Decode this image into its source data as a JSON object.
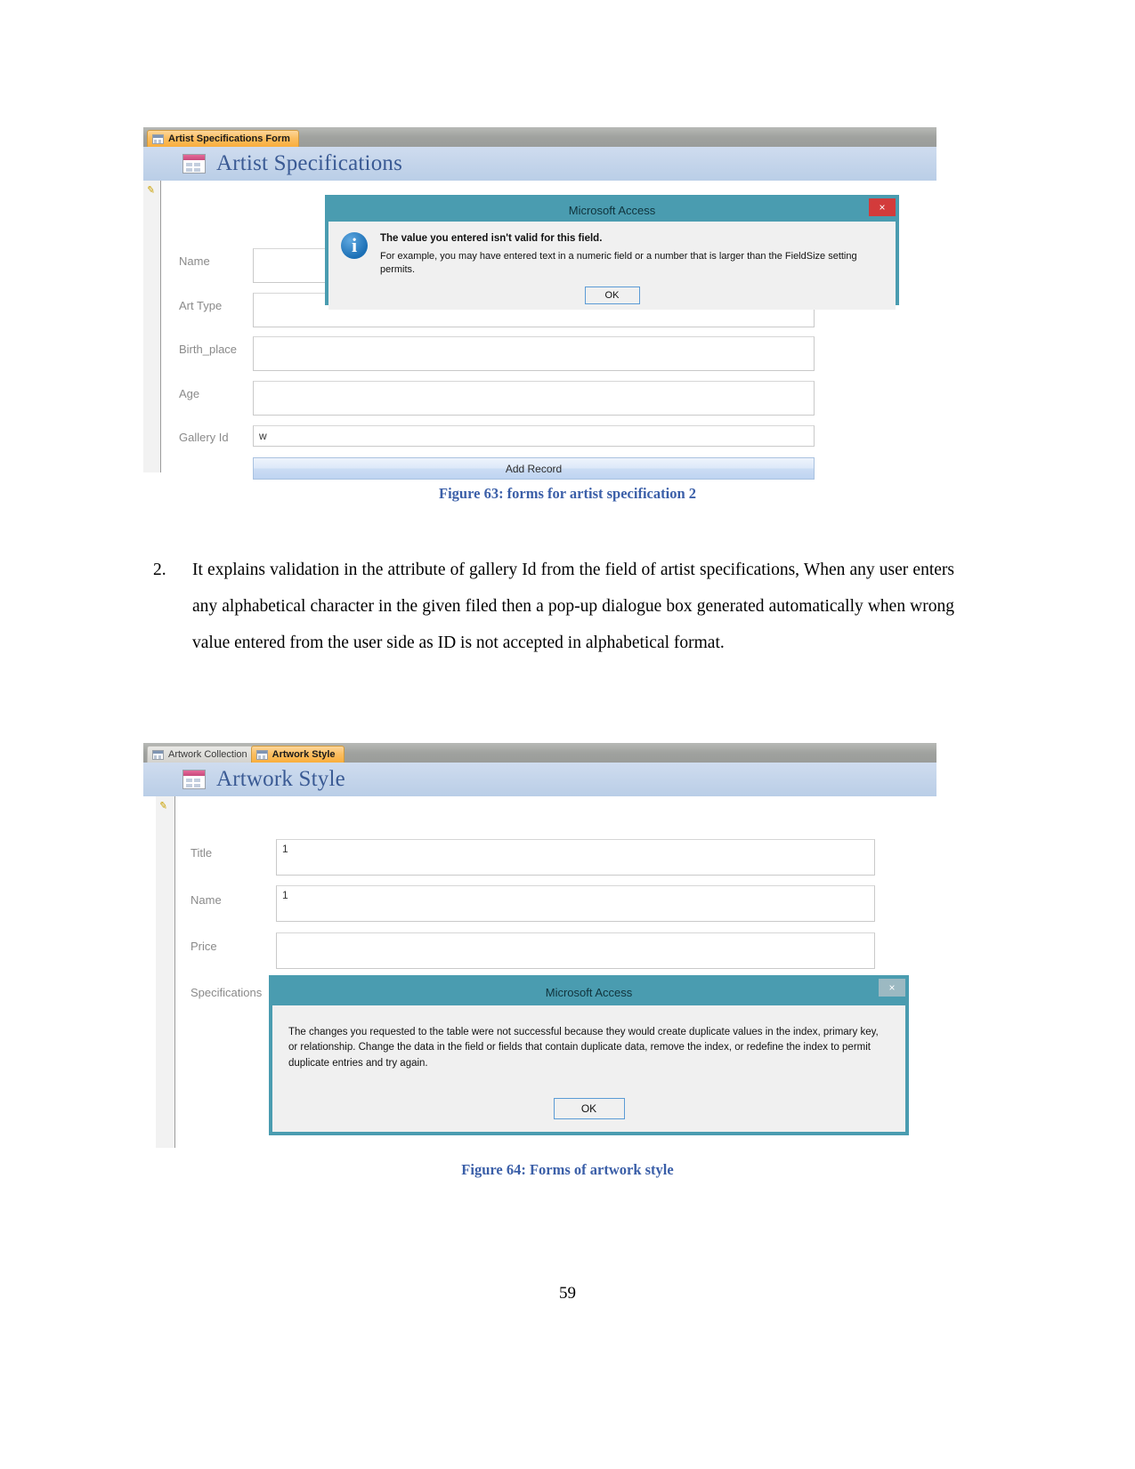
{
  "page": {
    "number": "59"
  },
  "figure1": {
    "tabs": [
      {
        "label": "Artist Specifications Form",
        "active": true
      }
    ],
    "form_title": "Artist Specifications",
    "fields": [
      {
        "label": "Name",
        "value": ""
      },
      {
        "label": "Art Type",
        "value": ""
      },
      {
        "label": "Birth_place",
        "value": ""
      },
      {
        "label": "Age",
        "value": ""
      },
      {
        "label": "Gallery Id",
        "value": "w"
      }
    ],
    "add_record_label": "Add Record",
    "dialog": {
      "title": "Microsoft Access",
      "close_label": "×",
      "heading": "The value you entered isn't valid for this field.",
      "detail": "For example, you may have entered text in a numeric field or a number that is larger than the FieldSize setting permits.",
      "ok_label": "OK",
      "icon": "info-icon",
      "icon_glyph": "i"
    },
    "caption": "Figure 63: forms for artist specification 2"
  },
  "paragraph": {
    "number": "2.",
    "text": "It explains validation in the attribute of gallery Id from the field of artist specifications, When any user enters any alphabetical character in the given filed then a pop-up dialogue box generated automatically when wrong value entered from the user side as ID is not accepted in alphabetical format."
  },
  "figure2": {
    "tabs": [
      {
        "label": "Artwork Collection",
        "active": false
      },
      {
        "label": "Artwork Style",
        "active": true
      }
    ],
    "form_title": "Artwork Style",
    "fields": [
      {
        "label": "Title",
        "value": "1"
      },
      {
        "label": "Name",
        "value": "1"
      },
      {
        "label": "Price",
        "value": ""
      },
      {
        "label": "Specifications",
        "value": ""
      }
    ],
    "dialog": {
      "title": "Microsoft Access",
      "close_label": "×",
      "message": "The changes you requested to the table were not successful because they would create duplicate values in the index, primary key, or relationship. Change the data in the field or fields that contain duplicate data, remove the index, or redefine the index to permit duplicate entries and try again.",
      "ok_label": "OK"
    },
    "caption": "Figure 64: Forms of artwork style"
  },
  "colors": {
    "dialog_accent": "#4a9cb0",
    "close_red": "#d33b3b",
    "caption_blue": "#3b5fa8",
    "form_title_blue": "#3a5a94",
    "tab_active": "#f9ae3c"
  }
}
